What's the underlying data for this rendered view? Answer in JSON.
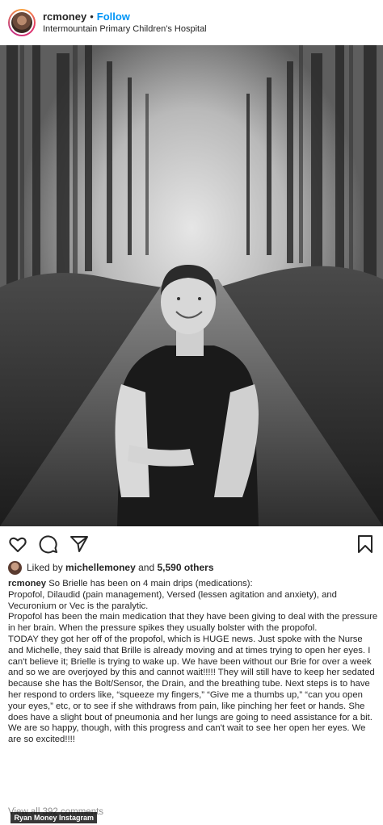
{
  "header": {
    "username": "rcmoney",
    "separator": "•",
    "follow_label": "Follow",
    "location": "Intermountain Primary Children's Hospital"
  },
  "photo": {
    "icon": "photo-of-smiling-girl-on-forest-road"
  },
  "actions": {
    "icons": [
      "heart-icon",
      "comment-icon",
      "share-icon",
      "bookmark-icon"
    ]
  },
  "likes": {
    "prefix": "Liked by",
    "user": "michellemoney",
    "conjunction": "and",
    "others": "5,590 others"
  },
  "caption": {
    "username": "rcmoney",
    "line1": " So Brielle has been on 4 main drips (medications):",
    "p2": "Propofol, Dilaudid (pain management), Versed (lessen agitation and anxiety), and Vecuronium or Vec is the paralytic.",
    "p3": "Propofol has been the main medication that they have been giving to deal with the pressure in her brain. When the pressure spikes they usually bolster with the propofol.",
    "p4": "TODAY they got her off of the propofol, which is HUGE news. Just spoke with the Nurse and Michelle, they said that Brille is already moving and at times trying to open her eyes. I can't believe it; Brielle is trying to wake up. We have been without our Brie for over a week and so we are overjoyed by this and cannot wait!!!!! They will still have to keep her sedated because she has the Bolt/Sensor, the Drain, and the breathing tube. Next steps is to have her respond to orders like, “squeeze my fingers,” “Give me a thumbs up,” “can you open your eyes,” etc, or to see if she withdraws from pain, like pinching her feet or hands. She does have a slight bout of pneumonia and her lungs are going to need assistance for a bit. We are so happy, though, with this progress and can't wait to see her open her eyes. We are so excited!!!!"
  },
  "comments": {
    "view_all": "View all 392 comments"
  },
  "credit": "Ryan Money Instagram"
}
